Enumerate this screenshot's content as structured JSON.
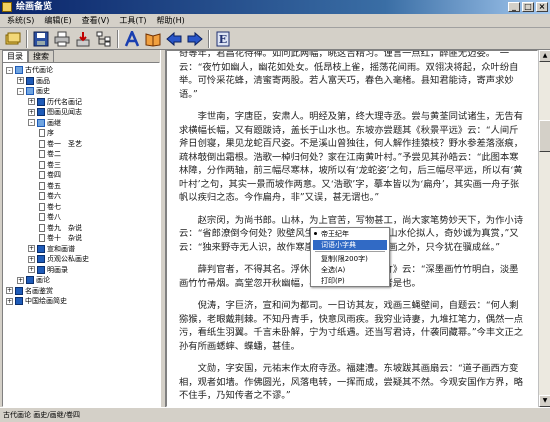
{
  "window": {
    "title": "绘画备览"
  },
  "menu": [
    "系统(S)",
    "编辑(E)",
    "查看(V)",
    "工具(T)",
    "帮助(H)"
  ],
  "toolbar": {
    "icons": [
      "folder-stack-icon",
      "save-disk-icon",
      "print-icon",
      "download-icon",
      "tree-structure-icon",
      "font-a-icon",
      "open-book-icon",
      "back-arrow-icon",
      "forward-arrow-icon",
      "info-e-icon"
    ],
    "e_label": "E"
  },
  "tabs": [
    "目录",
    "搜索"
  ],
  "tree": [
    {
      "label": "古代画论",
      "exp": "-",
      "icon": "open"
    },
    {
      "label": "画品",
      "exp": "+",
      "icon": "closed"
    },
    {
      "label": "画史",
      "exp": "-",
      "icon": "open"
    },
    {
      "label": "历代名画记",
      "exp": "+",
      "icon": "closed"
    },
    {
      "label": "图画见闻志",
      "exp": "+",
      "icon": "closed"
    },
    {
      "label": "画继",
      "exp": "-",
      "icon": "open"
    },
    {
      "label": "序",
      "exp": "",
      "icon": "page"
    },
    {
      "label": "卷一　圣艺",
      "exp": "",
      "icon": "page"
    },
    {
      "label": "卷二",
      "exp": "",
      "icon": "page"
    },
    {
      "label": "卷三",
      "exp": "",
      "icon": "page"
    },
    {
      "label": "卷四",
      "exp": "",
      "icon": "page"
    },
    {
      "label": "卷五",
      "exp": "",
      "icon": "page"
    },
    {
      "label": "卷六",
      "exp": "",
      "icon": "page"
    },
    {
      "label": "卷七",
      "exp": "",
      "icon": "page"
    },
    {
      "label": "卷八",
      "exp": "",
      "icon": "page"
    },
    {
      "label": "卷九　杂说",
      "exp": "",
      "icon": "page"
    },
    {
      "label": "卷十　杂说",
      "exp": "",
      "icon": "page"
    },
    {
      "label": "宣和画谱",
      "exp": "+",
      "icon": "closed"
    },
    {
      "label": "贞观公私画史",
      "exp": "+",
      "icon": "closed"
    },
    {
      "label": "明画录",
      "exp": "+",
      "icon": "closed"
    },
    {
      "label": "画论",
      "exp": "+",
      "icon": "closed"
    },
    {
      "label": "名画鉴赏",
      "exp": "+",
      "icon": "closed"
    },
    {
      "label": "中国绘画简史",
      "exp": "+",
      "icon": "closed"
    }
  ],
  "content": {
    "paragraphs": [
      "奇等年，君昌花待禅。如问此两幅，眺这吉精习。谨言一点红，醉匪无迈委。　一云：“夜竹如幽人，幽花如处女。低昂枝上雀，摇荡花间雨。双翎决将起，众叶纷自举。可怜采花蜂，清蜜寄两股。若人富天巧，春色入毫楮。县知君能诗，寄声求妙语。”",
      "李世南，字唐臣，安肃人。明经及第，终大理寺丞。尝与黄荃同试诸生，无告有求横幅长幅，又有题跋诗，盖长于山水也。东坡亦尝题其《秋景平远》云：“人间斤斧日创寝，果见龙蛇百尺姿。不是溪山曾独往，何人解作挂猿枝？野水参差落涨痕，疏林攲倒出霜根。浩歌一棹归何处？家在江南黄叶村。”予尝见其孙皓云：“此图本寒林障，分作两轴，前三幅尽寒林，坡所以有‘龙蛇姿’之句，后三幅尽平远，所以有‘黄叶村’之句，其实一景而坡作两意。又‘浩歌’字，摹本皆以为‘扁舟’，其实画一舟子张帆以疾归之态。今作扁舟，非”又误，甚无谓也。”",
      "赵宗闵，为尚书郎。山林，为上官苦，写物甚工，尚大家笔势妙天下，为作小诗云：“省郎潦倒今何处？败壁风生写，时见此，雪中山水伦拟人，奇妙诚为真赏，”又云：“独来野寺无人识，故作寒崖雪压枝。诗人不在画之外，只今犹在骥成丝。”",
      "薛判官者，不得其名。浮休题其所作《秋溪烟竹》云：“深墨画竹竹明白，淡墨画竹竹帚烟。高堂忽开秋幽幅，半隐半见如在然。”者是也。",
      "倪涛，字巨济，宣和间为都司。一日访其友，戏画三蝇壁间，自题云：“何人剩猕猴，老眼戴荆棘。不知丹青手，快意凤雨疾。我穷业诗妻，九堆扛笔力，偶然一点污，看纸生羽翼。千言未卧解，宁为寸纸遇。还当写君诗，什袭同藏幂。”今丰文正之孙有所画蟋蟀、蝶蟠，甚佳。",
      "文勋，字安国，元祐末作太府寺丞。福建漕。东坡跋其画扇云：“道子画西方变相，观者如墙。作佛圆光，风落电转，一挥而成，尝疑其不然。今观安国作方界，略不住手，乃知传者之不谬。”"
    ]
  },
  "context_menu": {
    "items": [
      "帝王纪年",
      "词语小字典",
      "复制(限200字)",
      "全选(A)",
      "打印(P)"
    ],
    "selected_index": 1
  },
  "status": {
    "path": "古代画论 画史/画继/卷四"
  }
}
